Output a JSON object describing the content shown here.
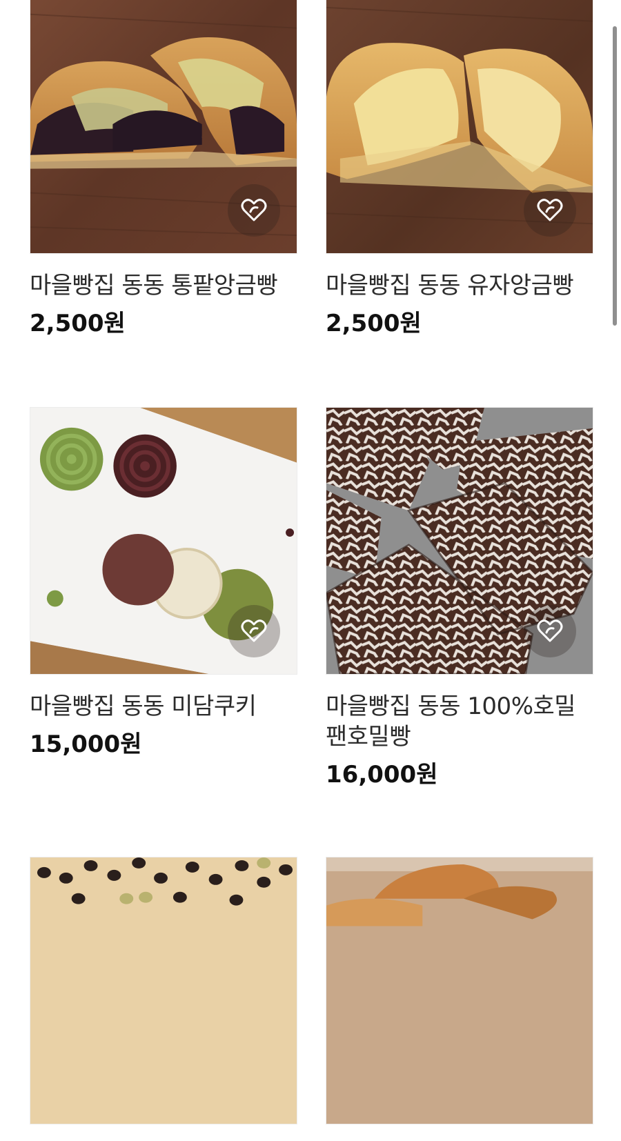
{
  "products": [
    {
      "title": "마을빵집 동동 통팥앙금빵",
      "price": "2,500원",
      "image": "red-bean-bun",
      "wish_icon": "heart-outline-icon"
    },
    {
      "title": "마을빵집 동동 유자앙금빵",
      "price": "2,500원",
      "image": "yuzu-bun",
      "wish_icon": "heart-outline-icon"
    },
    {
      "title": "마을빵집 동동 미담쿠키",
      "price": "15,000원",
      "image": "cookies",
      "wish_icon": "heart-outline-icon"
    },
    {
      "title": "마을빵집 동동 100%호밀 팬호밀빵",
      "price": "16,000원",
      "image": "rye-bread",
      "wish_icon": "heart-outline-icon"
    },
    {
      "title": "",
      "price": "",
      "image": "olive-focaccia"
    },
    {
      "title": "",
      "price": "",
      "image": "ciabatta"
    }
  ],
  "colors": {
    "text": "#111111",
    "title_text": "#2b2b2b",
    "scrollbar": "#8f8f8f"
  }
}
